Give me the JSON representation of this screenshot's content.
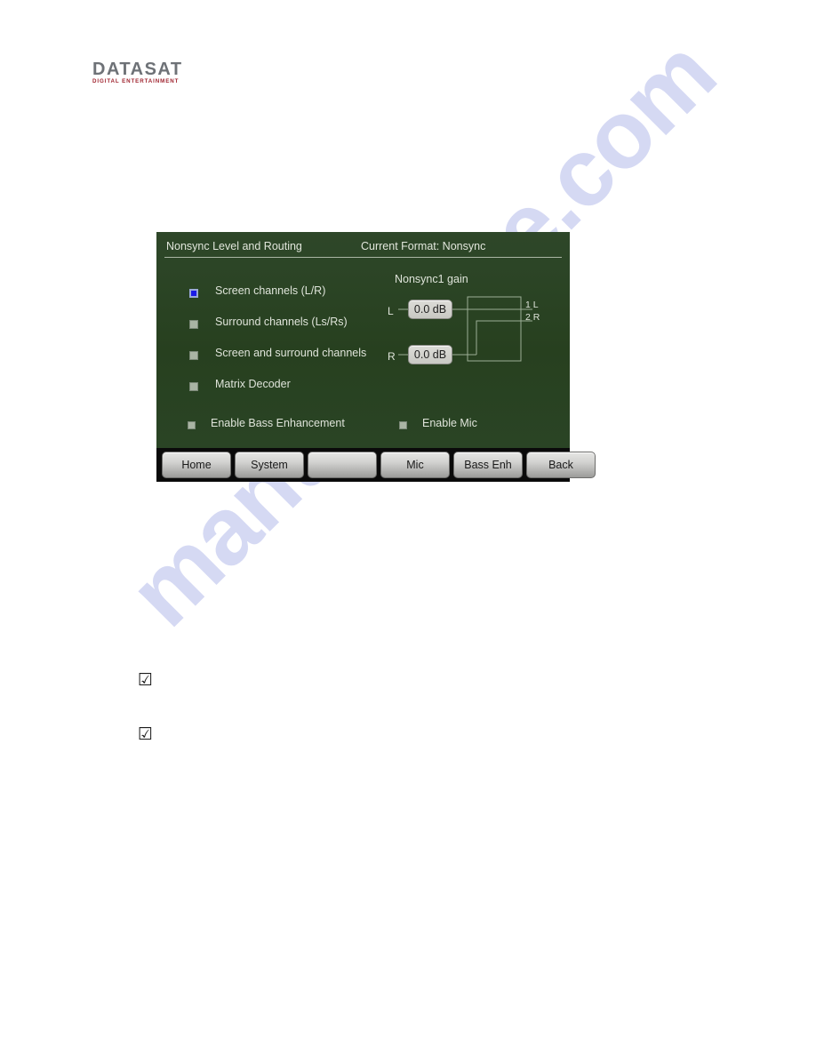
{
  "document": {
    "background_color": "#ffffff",
    "watermark_text": "manualshive.com",
    "watermark_color": "#c8cdf0",
    "standalone_checkmarks": [
      {
        "glyph": "☑",
        "name": "checked-box-glyph-1"
      },
      {
        "glyph": "☑",
        "name": "checked-box-glyph-2"
      }
    ]
  },
  "logo": {
    "primary": "DATASAT",
    "secondary": "DIGITAL ENTERTAINMENT",
    "primary_color": "#6e7277",
    "secondary_color": "#a02530"
  },
  "panel": {
    "screen_background": "#2b4226",
    "header": {
      "title": "Nonsync Level and Routing",
      "current_format": "Current Format: Nonsync"
    },
    "routing_options": [
      {
        "label": "Screen channels (L/R)",
        "selected": true
      },
      {
        "label": "Surround channels (Ls/Rs)",
        "selected": false
      },
      {
        "label": "Screen and surround channels",
        "selected": false
      },
      {
        "label": "Matrix Decoder",
        "selected": false
      }
    ],
    "gain": {
      "title": "Nonsync1 gain",
      "selected_color": "#1a1ae8",
      "channels": [
        {
          "input_label": "L",
          "value": "0.0 dB",
          "output_label": "1 L"
        },
        {
          "input_label": "R",
          "value": "0.0 dB",
          "output_label": "2 R"
        }
      ]
    },
    "checkboxes": [
      {
        "label": "Enable Bass Enhancement",
        "checked": false
      },
      {
        "label": "Enable Mic",
        "checked": false
      }
    ],
    "nav_buttons": [
      {
        "label": "Home"
      },
      {
        "label": "System"
      },
      {
        "label": ""
      },
      {
        "label": "Mic"
      },
      {
        "label": "Bass Enh"
      },
      {
        "label": "Back"
      }
    ]
  }
}
